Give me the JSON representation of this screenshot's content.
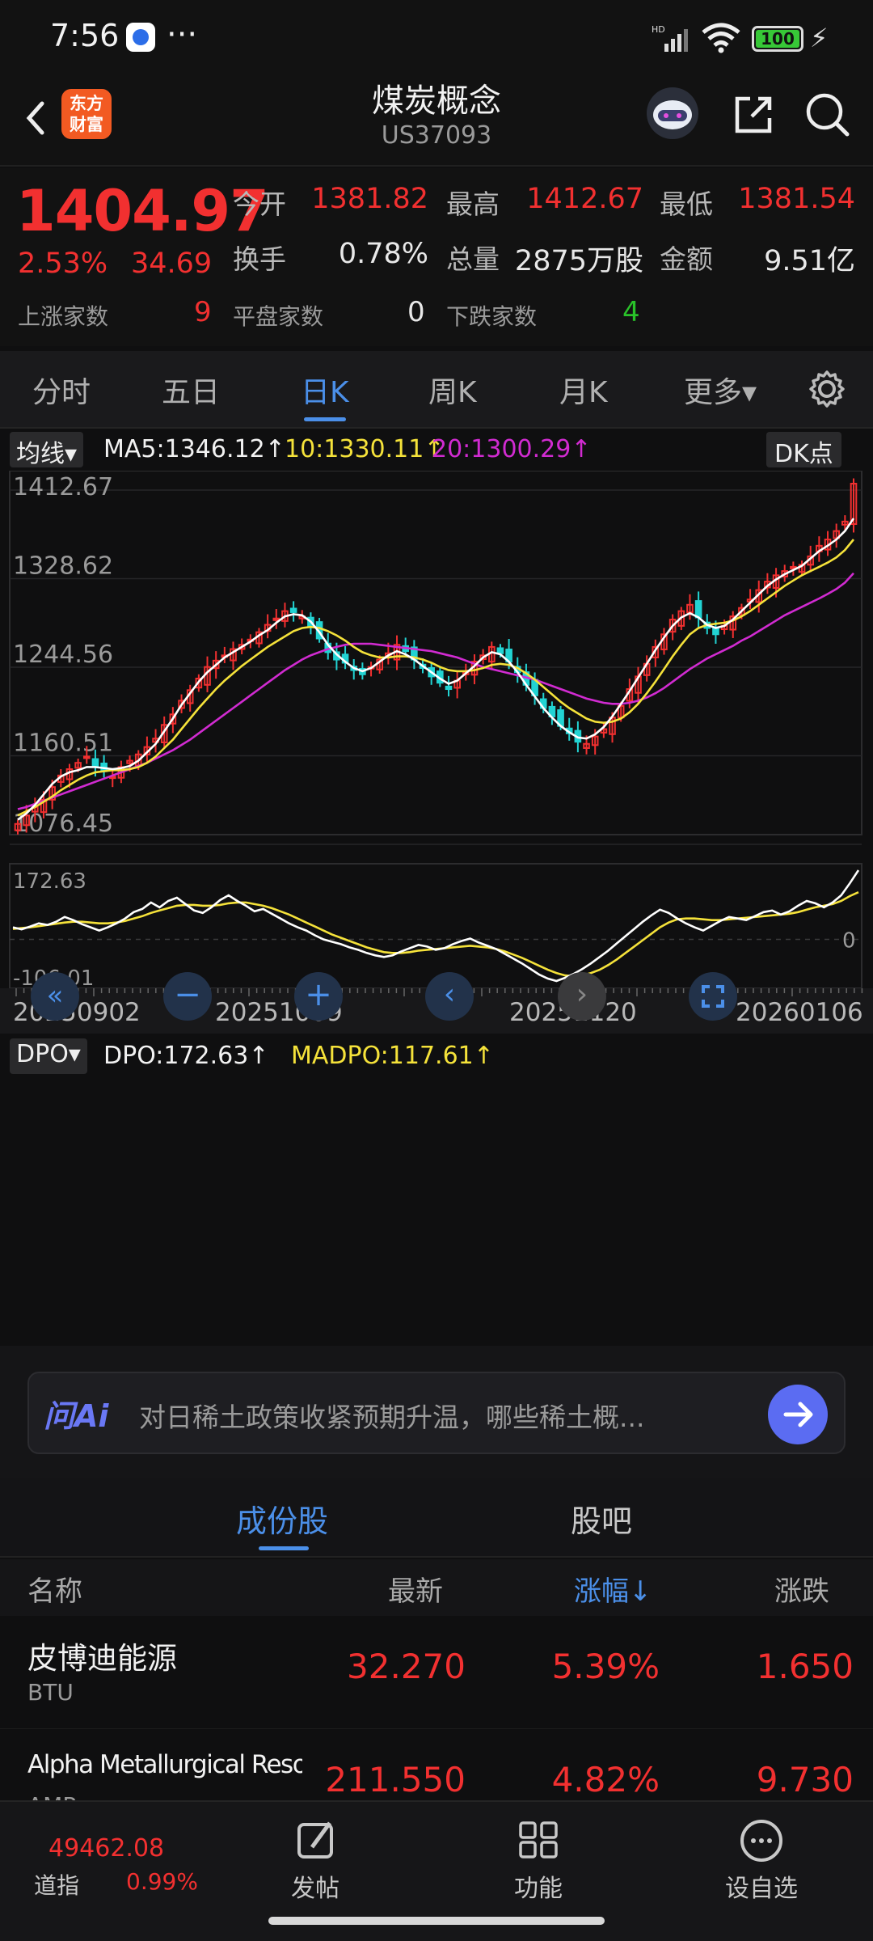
{
  "status": {
    "time": "7:56",
    "dots": "···",
    "battery": "100"
  },
  "header": {
    "title": "煤炭概念",
    "code": "US37093",
    "logo_line1": "东方",
    "logo_line2": "财富"
  },
  "quote": {
    "price": "1404.97",
    "change_pct": "2.53%",
    "change": "34.69",
    "open_label": "今开",
    "open": "1381.82",
    "high_label": "最高",
    "high": "1412.67",
    "low_label": "最低",
    "low": "1381.54",
    "turnover_label": "换手",
    "turnover": "0.78%",
    "volume_label": "总量",
    "volume": "2875万股",
    "amount_label": "金额",
    "amount": "9.51亿",
    "up_label": "上涨家数",
    "up": "9",
    "flat_label": "平盘家数",
    "flat": "0",
    "down_label": "下跌家数",
    "down": "4"
  },
  "tabs": [
    "分时",
    "五日",
    "日K",
    "周K",
    "月K",
    "更多▾"
  ],
  "active_tab": "日K",
  "indicators": {
    "ma_selector": "均线▾",
    "ma5": "MA5:1346.12↑",
    "ma10": "10:1330.11↑",
    "ma20": "20:1300.29↑",
    "dk_button": "DK点",
    "dpo_selector": "DPO▾",
    "dpo": "DPO:172.63↑",
    "madpo": "MADPO:117.61↑"
  },
  "colors": {
    "up": "#f23030",
    "down": "#22d3d3",
    "ma5": "#ffffff",
    "ma10": "#f5e23a",
    "ma20": "#d12bd1",
    "accent": "#4b8fe8"
  },
  "chart_data": [
    {
      "type": "candlestick",
      "y_tick_labels": [
        "1412.67",
        "1328.62",
        "1244.56",
        "1160.51",
        "1076.45"
      ],
      "ylim": [
        1076.45,
        1412.67
      ],
      "series_names": [
        "MA5",
        "MA10",
        "MA20"
      ],
      "close": [
        1082,
        1090,
        1098,
        1105,
        1117,
        1128,
        1134,
        1140,
        1146,
        1137,
        1132,
        1127,
        1136,
        1142,
        1148,
        1155,
        1163,
        1176,
        1186,
        1199,
        1209,
        1220,
        1231,
        1237,
        1242,
        1248,
        1252,
        1257,
        1264,
        1271,
        1277,
        1284,
        1283,
        1279,
        1270,
        1258,
        1245,
        1238,
        1235,
        1228,
        1224,
        1231,
        1238,
        1244,
        1252,
        1246,
        1238,
        1230,
        1222,
        1216,
        1210,
        1218,
        1226,
        1236,
        1242,
        1250,
        1244,
        1236,
        1226,
        1214,
        1204,
        1192,
        1184,
        1175,
        1168,
        1160,
        1158,
        1165,
        1172,
        1183,
        1194,
        1210,
        1222,
        1234,
        1250,
        1262,
        1276,
        1284,
        1290,
        1278,
        1268,
        1262,
        1270,
        1279,
        1287,
        1295,
        1304,
        1312,
        1318,
        1322,
        1326,
        1328,
        1336,
        1346,
        1352,
        1360,
        1369,
        1404.97
      ],
      "ma5": [
        1086,
        1092,
        1100,
        1110,
        1120,
        1127,
        1131,
        1133,
        1136,
        1136,
        1135,
        1134,
        1135,
        1137,
        1142,
        1150,
        1158,
        1170,
        1182,
        1195,
        1206,
        1217,
        1226,
        1233,
        1240,
        1245,
        1250,
        1255,
        1261,
        1266,
        1273,
        1279,
        1281,
        1280,
        1274,
        1264,
        1252,
        1243,
        1236,
        1230,
        1227,
        1230,
        1236,
        1242,
        1246,
        1243,
        1238,
        1232,
        1226,
        1220,
        1215,
        1218,
        1225,
        1232,
        1240,
        1245,
        1243,
        1236,
        1226,
        1214,
        1203,
        1192,
        1183,
        1175,
        1169,
        1164,
        1163,
        1167,
        1174,
        1184,
        1196,
        1208,
        1221,
        1234,
        1247,
        1259,
        1270,
        1278,
        1282,
        1278,
        1271,
        1268,
        1270,
        1276,
        1284,
        1292,
        1300,
        1308,
        1314,
        1319,
        1323,
        1327,
        1334,
        1341,
        1346.12,
        1352,
        1360,
        1372
      ],
      "ma10": [
        1090,
        1094,
        1098,
        1103,
        1108,
        1114,
        1119,
        1124,
        1128,
        1131,
        1132,
        1133,
        1133,
        1134,
        1136,
        1140,
        1146,
        1154,
        1162,
        1172,
        1182,
        1192,
        1201,
        1210,
        1218,
        1225,
        1232,
        1238,
        1244,
        1250,
        1255,
        1260,
        1265,
        1268,
        1269,
        1268,
        1265,
        1261,
        1256,
        1250,
        1245,
        1242,
        1240,
        1240,
        1241,
        1241,
        1240,
        1238,
        1235,
        1231,
        1228,
        1227,
        1227,
        1228,
        1230,
        1233,
        1234,
        1233,
        1230,
        1225,
        1219,
        1212,
        1205,
        1198,
        1192,
        1187,
        1182,
        1179,
        1178,
        1179,
        1182,
        1188,
        1196,
        1206,
        1217,
        1229,
        1241,
        1252,
        1262,
        1268,
        1271,
        1272,
        1273,
        1275,
        1279,
        1284,
        1290,
        1296,
        1302,
        1308,
        1313,
        1318,
        1322,
        1326,
        1330.11,
        1335,
        1342,
        1352
      ],
      "ma20": [
        1096,
        1098,
        1101,
        1104,
        1107,
        1110,
        1113,
        1116,
        1119,
        1122,
        1125,
        1128,
        1131,
        1134,
        1137,
        1140,
        1144,
        1148,
        1152,
        1157,
        1162,
        1168,
        1174,
        1180,
        1186,
        1192,
        1198,
        1204,
        1210,
        1216,
        1222,
        1228,
        1233,
        1238,
        1242,
        1245,
        1248,
        1250,
        1252,
        1253,
        1253,
        1253,
        1252,
        1251,
        1250,
        1249,
        1248,
        1247,
        1246,
        1244,
        1242,
        1240,
        1237,
        1234,
        1231,
        1229,
        1227,
        1225,
        1223,
        1221,
        1219,
        1216,
        1213,
        1210,
        1207,
        1204,
        1201,
        1199,
        1197,
        1196,
        1196,
        1197,
        1199,
        1202,
        1206,
        1211,
        1217,
        1223,
        1229,
        1234,
        1239,
        1243,
        1247,
        1251,
        1256,
        1260,
        1265,
        1270,
        1275,
        1280,
        1284,
        1288,
        1292,
        1296,
        1300.29,
        1305,
        1311,
        1320
      ]
    },
    {
      "type": "line",
      "series_names": [
        "DPO",
        "MADPO"
      ],
      "y_tick_labels": [
        "172.63",
        "0",
        "-106.01"
      ],
      "ylim": [
        -106.01,
        172.63
      ],
      "dpo": [
        30,
        25,
        32,
        40,
        36,
        44,
        56,
        48,
        38,
        30,
        22,
        30,
        40,
        52,
        68,
        76,
        92,
        80,
        96,
        104,
        88,
        72,
        66,
        80,
        98,
        110,
        96,
        84,
        70,
        76,
        64,
        52,
        40,
        30,
        22,
        10,
        0,
        -6,
        -12,
        -20,
        -26,
        -34,
        -40,
        -44,
        -40,
        -30,
        -22,
        -14,
        -18,
        -26,
        -22,
        -12,
        -4,
        2,
        -8,
        -16,
        -24,
        -36,
        -48,
        -60,
        -74,
        -88,
        -98,
        -104,
        -96,
        -86,
        -74,
        -60,
        -44,
        -28,
        -10,
        8,
        26,
        44,
        60,
        74,
        66,
        52,
        40,
        30,
        22,
        34,
        46,
        56,
        52,
        48,
        58,
        68,
        72,
        62,
        70,
        84,
        96,
        90,
        80,
        92,
        110,
        140,
        172.63
      ],
      "madpo": [
        26,
        28,
        30,
        33,
        36,
        39,
        42,
        44,
        44,
        42,
        40,
        40,
        42,
        46,
        52,
        58,
        66,
        72,
        78,
        84,
        86,
        86,
        84,
        84,
        86,
        90,
        92,
        92,
        88,
        84,
        78,
        70,
        62,
        52,
        42,
        32,
        22,
        12,
        4,
        -4,
        -12,
        -20,
        -26,
        -32,
        -34,
        -34,
        -32,
        -28,
        -26,
        -24,
        -22,
        -20,
        -18,
        -16,
        -18,
        -20,
        -24,
        -30,
        -38,
        -46,
        -56,
        -66,
        -76,
        -84,
        -90,
        -92,
        -90,
        -84,
        -76,
        -64,
        -50,
        -34,
        -18,
        -2,
        14,
        30,
        42,
        50,
        52,
        52,
        50,
        48,
        48,
        50,
        52,
        54,
        56,
        58,
        60,
        62,
        64,
        68,
        74,
        80,
        84,
        88,
        96,
        108,
        117.61
      ]
    }
  ],
  "dates": [
    "20250902",
    "20251009",
    "20251120",
    "20260106"
  ],
  "ai": {
    "logo": "问Ai",
    "prompt": "对日稀土政策收紧预期升温，哪些稀土概..."
  },
  "subtabs": [
    "成份股",
    "股吧"
  ],
  "list": {
    "headers": {
      "name": "名称",
      "latest": "最新",
      "pct": "涨幅↓",
      "chg": "涨跌"
    },
    "rows": [
      {
        "name": "皮博迪能源",
        "code": "BTU",
        "latest": "32.270",
        "pct": "5.39%",
        "chg": "1.650"
      },
      {
        "name": "Alpha Metallurgical Resources I",
        "code": "AMR",
        "latest": "211.550",
        "pct": "4.82%",
        "chg": "9.730"
      }
    ]
  },
  "bottom": {
    "index_value": "49462.08",
    "index_label": "道指",
    "index_pct": "0.99%",
    "post": "发帖",
    "features": "功能",
    "watchlist": "设自选"
  }
}
